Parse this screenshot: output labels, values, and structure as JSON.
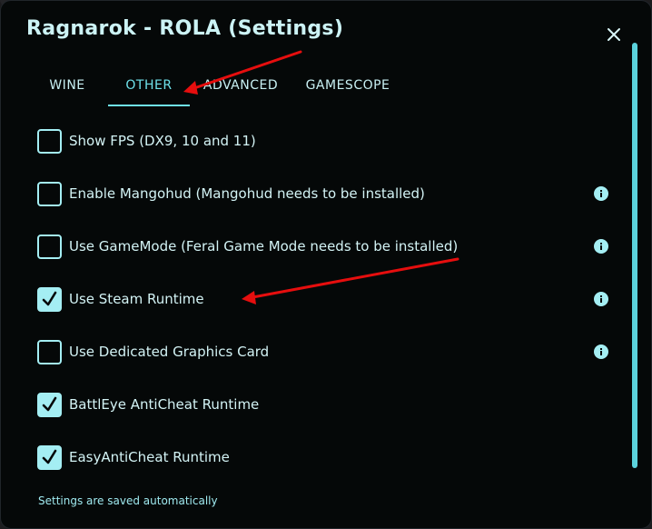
{
  "dialog": {
    "title": "Ragnarok - ROLA (Settings)",
    "footer_note": "Settings are saved automatically"
  },
  "tabs": [
    {
      "label": "WINE",
      "active": false
    },
    {
      "label": "OTHER",
      "active": true
    },
    {
      "label": "ADVANCED",
      "active": false
    },
    {
      "label": "GAMESCOPE",
      "active": false
    }
  ],
  "options": [
    {
      "label": "Show FPS (DX9, 10 and 11)",
      "checked": false,
      "has_info": false
    },
    {
      "label": "Enable Mangohud (Mangohud needs to be installed)",
      "checked": false,
      "has_info": true
    },
    {
      "label": "Use GameMode (Feral Game Mode needs to be installed)",
      "checked": false,
      "has_info": true
    },
    {
      "label": "Use Steam Runtime",
      "checked": true,
      "has_info": true
    },
    {
      "label": "Use Dedicated Graphics Card",
      "checked": false,
      "has_info": true
    },
    {
      "label": "BattlEye AntiCheat Runtime",
      "checked": true,
      "has_info": false
    },
    {
      "label": "EasyAntiCheat Runtime",
      "checked": true,
      "has_info": false
    }
  ],
  "icons": {
    "close": "close-icon",
    "info": "info-icon",
    "check": "checkmark-icon"
  },
  "colors": {
    "accent": "#6ee1ea",
    "checkbox": "#a4eef3",
    "background": "#050808",
    "annotation_arrow": "#e60e0e"
  }
}
